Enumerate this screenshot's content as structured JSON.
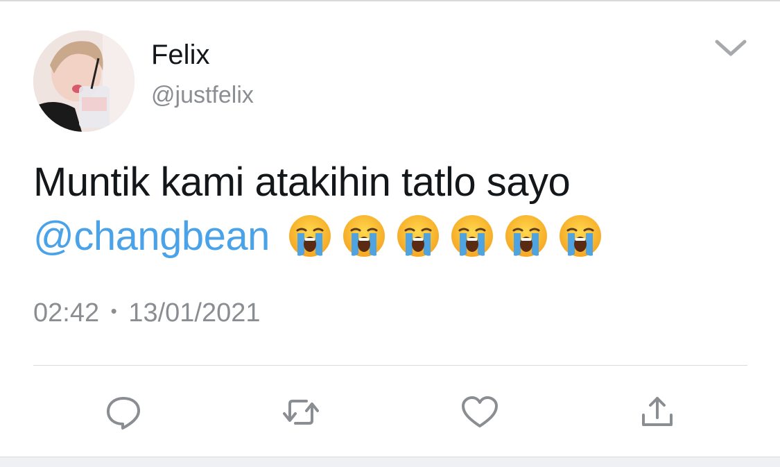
{
  "tweet": {
    "display_name": "Felix",
    "handle": "@justfelix",
    "text_main": "Muntik kami atakihin tatlo sayo",
    "mention": "@changbean",
    "emoji": "loudly-crying-face",
    "emoji_count": 6,
    "time": "02:42",
    "separator": "•",
    "date": "13/01/2021"
  },
  "icons": {
    "menu": "chevron-down-icon",
    "reply": "reply-icon",
    "retweet": "retweet-icon",
    "like": "heart-icon",
    "share": "share-icon"
  },
  "colors": {
    "text": "#14171a",
    "secondary": "#8a8d91",
    "link": "#4aa3e8",
    "divider": "#d9dadc"
  }
}
